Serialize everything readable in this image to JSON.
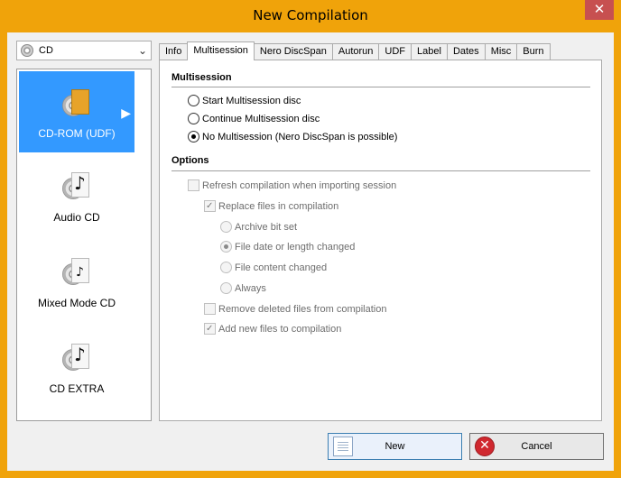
{
  "window": {
    "title": "New Compilation",
    "close_glyph": "✕"
  },
  "disc_type": {
    "selected": "CD"
  },
  "compilation_types": [
    {
      "label": "CD-ROM (UDF)",
      "selected": true,
      "icon": "cd-rom-udf-icon"
    },
    {
      "label": "Audio CD",
      "selected": false,
      "icon": "audio-cd-icon"
    },
    {
      "label": "Mixed Mode CD",
      "selected": false,
      "icon": "mixed-mode-cd-icon"
    },
    {
      "label": "CD EXTRA",
      "selected": false,
      "icon": "cd-extra-icon"
    }
  ],
  "tabs": [
    {
      "label": "Info",
      "active": false
    },
    {
      "label": "Multisession",
      "active": true
    },
    {
      "label": "Nero DiscSpan",
      "active": false
    },
    {
      "label": "Autorun",
      "active": false
    },
    {
      "label": "UDF",
      "active": false
    },
    {
      "label": "Label",
      "active": false
    },
    {
      "label": "Dates",
      "active": false
    },
    {
      "label": "Misc",
      "active": false
    },
    {
      "label": "Burn",
      "active": false
    }
  ],
  "multisession": {
    "heading": "Multisession",
    "options": [
      {
        "label": "Start Multisession disc",
        "checked": false
      },
      {
        "label": "Continue Multisession disc",
        "checked": false
      },
      {
        "label": "No Multisession (Nero DiscSpan is possible)",
        "checked": true
      }
    ]
  },
  "options": {
    "heading": "Options",
    "refresh": {
      "label": "Refresh compilation when importing session",
      "checked": false
    },
    "replace": {
      "label": "Replace files in compilation",
      "checked": true
    },
    "replace_modes": [
      {
        "label": "Archive bit set",
        "checked": false
      },
      {
        "label": "File date or length changed",
        "checked": true
      },
      {
        "label": "File content changed",
        "checked": false
      },
      {
        "label": "Always",
        "checked": false
      }
    ],
    "remove_deleted": {
      "label": "Remove deleted files from compilation",
      "checked": false
    },
    "add_new": {
      "label": "Add new files to compilation",
      "checked": true
    }
  },
  "buttons": {
    "new_label": "New",
    "cancel_label": "Cancel",
    "cancel_glyph": "✕"
  }
}
